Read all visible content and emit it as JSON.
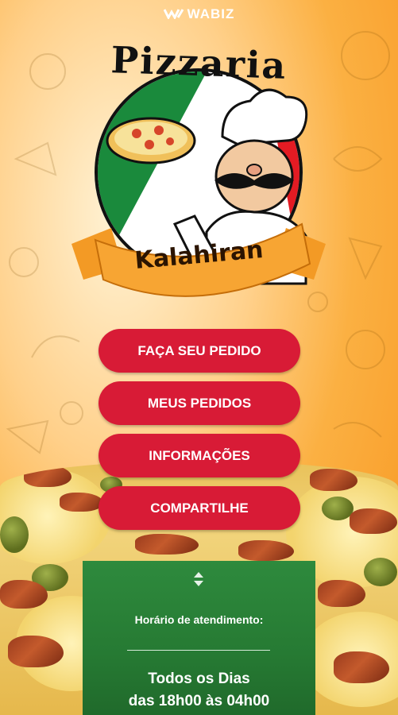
{
  "brand": {
    "name": "WABIZ"
  },
  "logo": {
    "title": "Pizzaria",
    "ribbon": "Kalahiran"
  },
  "menu": {
    "order_label": "FAÇA SEU PEDIDO",
    "my_orders_label": "MEUS PEDIDOS",
    "info_label": "INFORMAÇÕES",
    "share_label": "COMPARTILHE"
  },
  "hours": {
    "label": "Horário de atendimento:",
    "days": "Todos os Dias",
    "times": "das 18h00 às 04h00"
  },
  "colors": {
    "button": "#d81b36",
    "panel": "#2e8a3d",
    "accent": "#f7941d"
  }
}
